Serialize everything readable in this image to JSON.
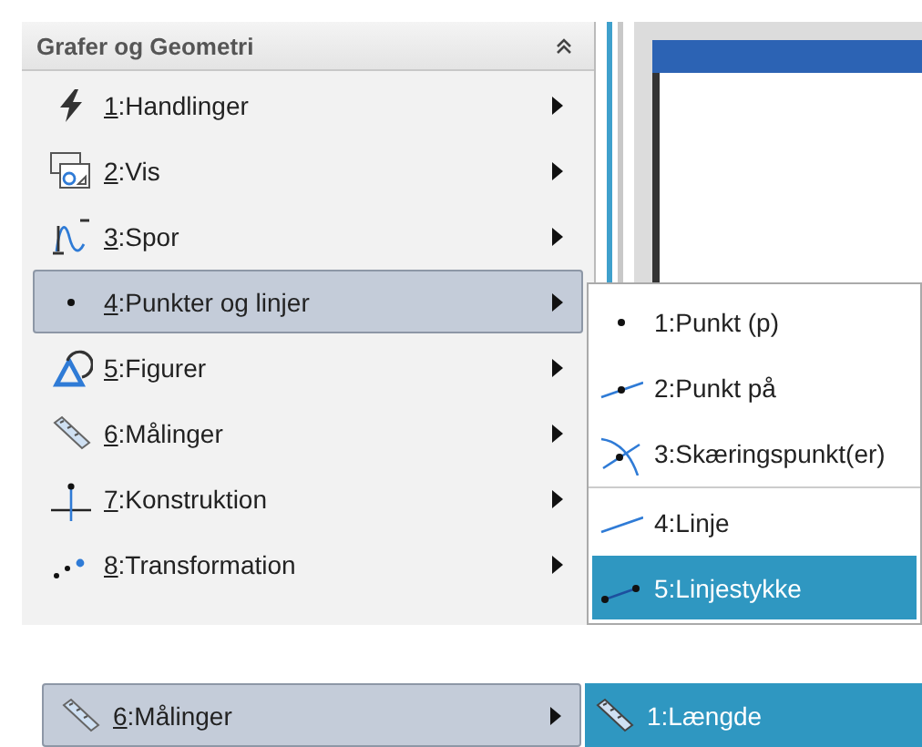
{
  "menu": {
    "title": "Grafer og Geometri",
    "items": [
      {
        "label": "1:Handlinger",
        "selected": false
      },
      {
        "label": "2:Vis",
        "selected": false
      },
      {
        "label": "3:Spor",
        "selected": false
      },
      {
        "label": "4:Punkter og linjer",
        "selected": true
      },
      {
        "label": "5:Figurer",
        "selected": false
      },
      {
        "label": "6:Målinger",
        "selected": false
      },
      {
        "label": "7:Konstruktion",
        "selected": false
      },
      {
        "label": "8:Transformation",
        "selected": false
      }
    ]
  },
  "submenu": {
    "items": [
      {
        "label": "1:Punkt (p)",
        "selected": false,
        "divider_above": false
      },
      {
        "label": "2:Punkt på",
        "selected": false,
        "divider_above": false
      },
      {
        "label": "3:Skæringspunkt(er)",
        "selected": false,
        "divider_above": false
      },
      {
        "label": "4:Linje",
        "selected": false,
        "divider_above": true
      },
      {
        "label": "5:Linjestykke",
        "selected": true,
        "divider_above": false
      }
    ]
  },
  "detail": {
    "menu_item": {
      "label": "6:Målinger",
      "selected": true
    },
    "submenu_item": {
      "label": "1:Længde",
      "selected": true
    }
  }
}
